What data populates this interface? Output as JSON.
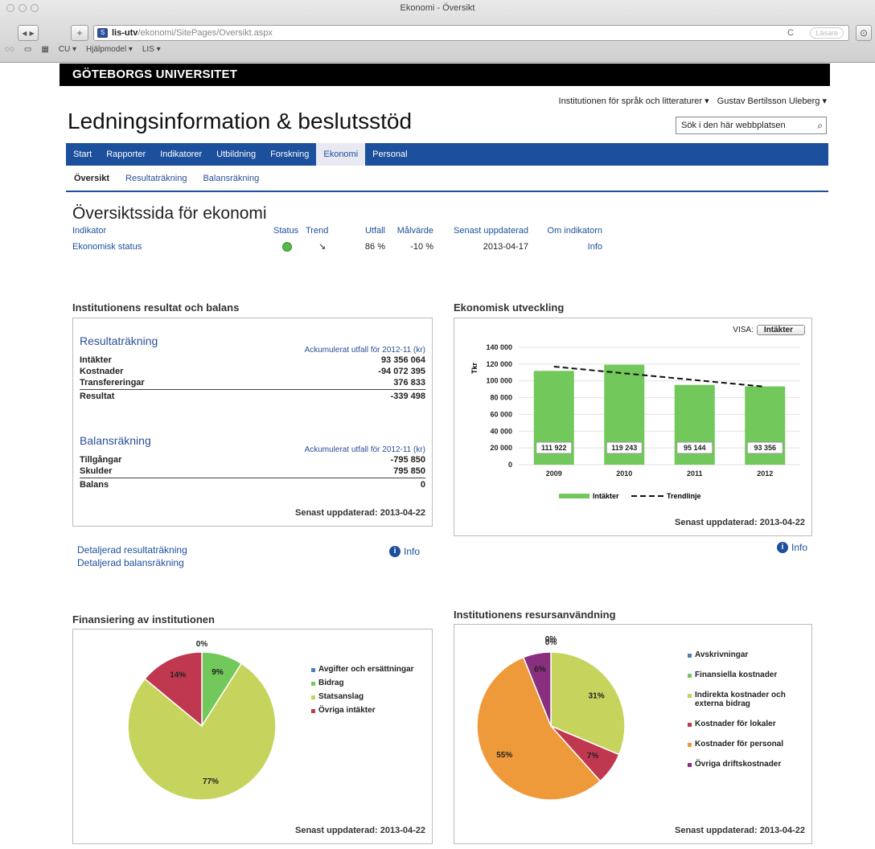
{
  "browser": {
    "window_title": "Ekonomi - Översikt",
    "url_host": "lis-utv",
    "url_path": "/ekonomi/SitePages/Oversikt.aspx",
    "reader_label": "Läsare",
    "bookmarks": [
      "CU ▾",
      "Hjälpmodel ▾",
      "LIS ▾"
    ]
  },
  "university": "GÖTEBORGS UNIVERSITET",
  "site_title": "Ledningsinformation & beslutsstöd",
  "user_links": {
    "department": "Institutionen för språk och litteraturer ▾",
    "user": "Gustav Bertilsson Uleberg ▾"
  },
  "search": {
    "placeholder": "Sök i den här webbplatsen"
  },
  "main_nav": [
    "Start",
    "Rapporter",
    "Indikatorer",
    "Utbildning",
    "Forskning",
    "Ekonomi",
    "Personal"
  ],
  "sub_nav": [
    "Översikt",
    "Resultaträkning",
    "Balansräkning"
  ],
  "overview": {
    "title": "Översiktssida för ekonomi",
    "headers": [
      "Indikator",
      "Status",
      "Trend",
      "Utfall",
      "Målvärde",
      "Senast uppdaterad",
      "Om indikatorn"
    ],
    "row": {
      "indicator": "Ekonomisk status",
      "trend": "↘",
      "utfall": "86 %",
      "malvarde": "-10 %",
      "updated": "2013-04-17",
      "info": "Info"
    }
  },
  "result_panel": {
    "title": "Institutionens resultat och balans",
    "resultat_heading": "Resultaträkning",
    "resultat_sub": "Ackumulerat utfall för 2012-11 (kr)",
    "resultat_rows": [
      {
        "label": "Intäkter",
        "value": "93 356 064"
      },
      {
        "label": "Kostnader",
        "value": "-94 072 395"
      },
      {
        "label": "Transfereringar",
        "value": "376 833"
      }
    ],
    "resultat_total": {
      "label": "Resultat",
      "value": "-339 498"
    },
    "balans_heading": "Balansräkning",
    "balans_sub": "Ackumulerat utfall för 2012-11 (kr)",
    "balans_rows": [
      {
        "label": "Tillgångar",
        "value": "-795 850"
      },
      {
        "label": "Skulder",
        "value": "795 850"
      }
    ],
    "balans_total": {
      "label": "Balans",
      "value": "0"
    },
    "updated": "Senast uppdaterad: 2013-04-22",
    "link1": "Detaljerad resultaträkning",
    "link2": "Detaljerad balansräkning",
    "info": "Info"
  },
  "dev_panel": {
    "title": "Ekonomisk utveckling",
    "visa_label": "VISA:",
    "visa_value": "Intäkter",
    "updated": "Senast uppdaterad: 2013-04-22",
    "info": "Info"
  },
  "fin_panel": {
    "title": "Finansiering av institutionen",
    "updated": "Senast uppdaterad: 2013-04-22"
  },
  "res_panel": {
    "title": "Institutionens resursanvändning",
    "updated": "Senast uppdaterad: 2013-04-22"
  },
  "colors": {
    "nav": "#1c4f9c",
    "bar": "#72c85a",
    "yellowgreen": "#c6d35c",
    "red": "#c0384f",
    "orange": "#ef9a3a",
    "purple": "#8a2f7f"
  },
  "chart_data": [
    {
      "type": "bar",
      "title": "Ekonomisk utveckling",
      "ylabel": "Tkr",
      "categories": [
        "2009",
        "2010",
        "2011",
        "2012"
      ],
      "series": [
        {
          "name": "Intäkter",
          "values": [
            111922,
            119243,
            95144,
            93356
          ]
        },
        {
          "name": "Trendlinje",
          "values": [
            117000,
            109000,
            101000,
            93000
          ]
        }
      ],
      "data_labels": [
        "111 922",
        "119 243",
        "95 144",
        "93 356"
      ],
      "yticks": [
        "0",
        "20 000",
        "40 000",
        "60 000",
        "80 000",
        "100 000",
        "120 000",
        "140 000"
      ],
      "ylim": [
        0,
        140000
      ]
    },
    {
      "type": "pie",
      "title": "Finansiering av institutionen",
      "slices": [
        {
          "name": "Avgifter och ersättningar",
          "value": 0,
          "label": "0%",
          "color": "#4a7fc0"
        },
        {
          "name": "Bidrag",
          "value": 9,
          "label": "9%",
          "color": "#72c85a"
        },
        {
          "name": "Statsanslag",
          "value": 77,
          "label": "77%",
          "color": "#c6d35c"
        },
        {
          "name": "Övriga intäkter",
          "value": 14,
          "label": "14%",
          "color": "#c0384f"
        }
      ]
    },
    {
      "type": "pie",
      "title": "Institutionens resursanvändning",
      "slices": [
        {
          "name": "Avskrivningar",
          "value": 0,
          "label": "0%",
          "color": "#4a7fc0"
        },
        {
          "name": "Finansiella kostnader",
          "value": 0,
          "label": "0%",
          "color": "#72c85a"
        },
        {
          "name": "Indirekta kostnader och externa bidrag",
          "value": 31,
          "label": "31%",
          "color": "#c6d35c"
        },
        {
          "name": "Kostnader för lokaler",
          "value": 7,
          "label": "7%",
          "color": "#c0384f"
        },
        {
          "name": "Kostnader för personal",
          "value": 55,
          "label": "55%",
          "color": "#ef9a3a"
        },
        {
          "name": "Övriga driftskostnader",
          "value": 6,
          "label": "6%",
          "color": "#8a2f7f"
        }
      ]
    }
  ]
}
